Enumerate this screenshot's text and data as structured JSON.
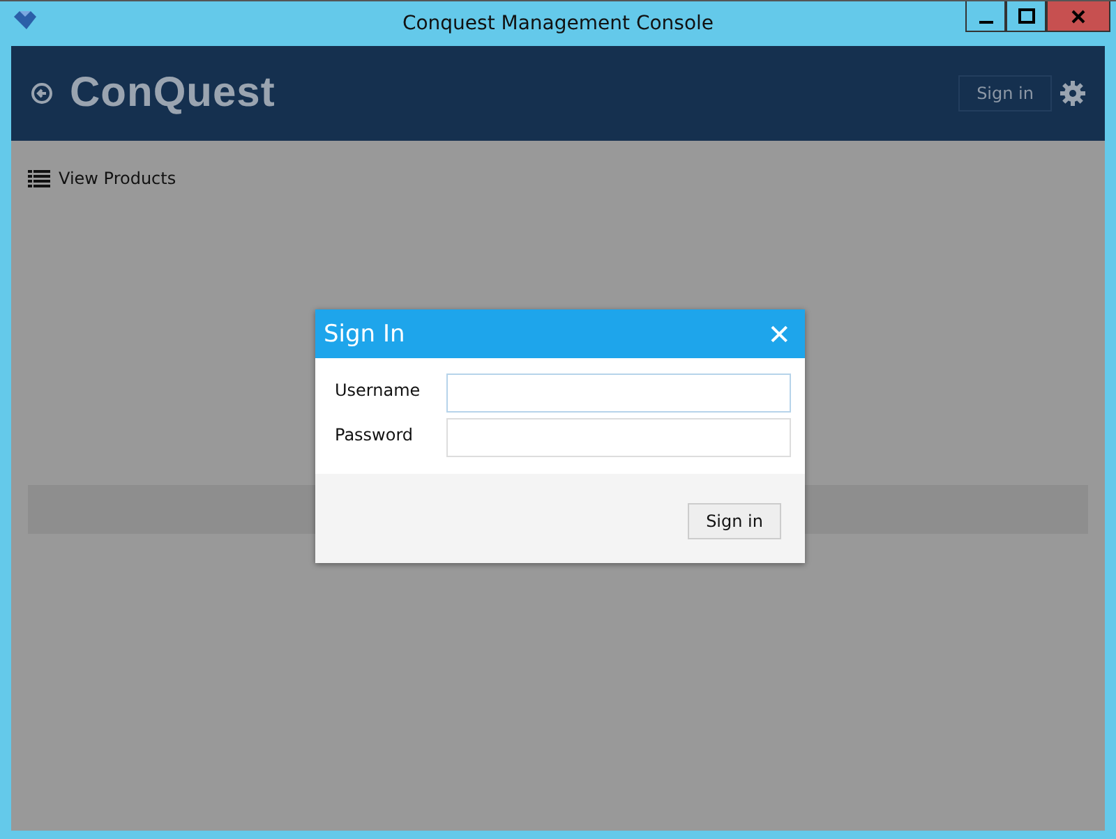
{
  "window": {
    "title": "Conquest Management Console"
  },
  "header": {
    "logo": "ConQuest",
    "sign_in_button": "Sign in"
  },
  "nav": {
    "link": "View Products"
  },
  "dialog": {
    "title": "Sign In",
    "close": "✕",
    "fields": [
      {
        "label": "Username",
        "focused": true
      },
      {
        "label": "Password",
        "focused": false
      }
    ],
    "submit": "Sign in"
  }
}
